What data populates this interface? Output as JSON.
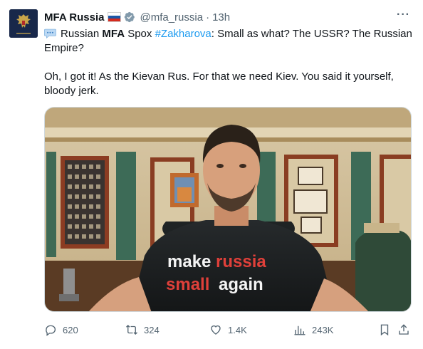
{
  "account": {
    "display_name": "MFA Russia",
    "handle": "@mfa_russia",
    "separator": "·",
    "time_ago": "13h"
  },
  "tweet": {
    "segment_1": "Russian ",
    "segment_2": "MFA",
    "segment_3": " Spox ",
    "hashtag": "#Zakharova",
    "segment_4": ": Small as what? The USSR? The Russian Empire?",
    "paragraph_2": "Oh, I got it! As the Kievan Rus. For that we need Kiev. You said it yourself, bloody jerk."
  },
  "media": {
    "shirt_line_1a": "make ",
    "shirt_line_1b": "russia",
    "shirt_line_2a": "small",
    "shirt_line_2b": "again"
  },
  "actions": {
    "replies": "620",
    "reposts": "324",
    "likes": "1.4K",
    "views": "243K"
  },
  "icons": [
    "speech-bubble-icon",
    "verified-badge-icon",
    "russian-flag-icon",
    "more-icon",
    "reply-icon",
    "repost-icon",
    "like-icon",
    "views-icon",
    "bookmark-icon",
    "share-icon"
  ],
  "colors": {
    "link": "#1d9bf0",
    "secondary_text": "#536471",
    "primary_text": "#0f1419",
    "shirt_red": "#e0403a"
  }
}
